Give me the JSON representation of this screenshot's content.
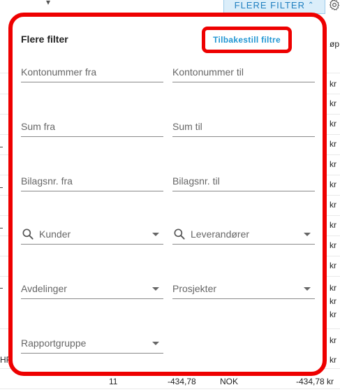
{
  "topbar": {
    "more_filters_label": "FLERE FILTER",
    "more_filters_chevron": "chevron-up-icon",
    "settings_icon": "gear-icon"
  },
  "background": {
    "column_header_fragment": "øp",
    "currency_cells": [
      "kr",
      "kr",
      "kr",
      "kr",
      "kr",
      "kr",
      "kr",
      "kr",
      "kr",
      "kr",
      "kr",
      "kr",
      "kr",
      "kr",
      "kr",
      "kr"
    ],
    "row_fragment": "HF",
    "bottom_row": {
      "count": "11",
      "amount": "-434,78",
      "currency": "NOK",
      "total": "-434,78 kr"
    }
  },
  "modal": {
    "title": "Flere filter",
    "reset_label": "Tilbakestill filtre",
    "fields": {
      "account_from": "Kontonummer fra",
      "account_to": "Kontonummer til",
      "sum_from": "Sum fra",
      "sum_to": "Sum til",
      "voucher_from": "Bilagsnr. fra",
      "voucher_to": "Bilagsnr. til",
      "customers": "Kunder",
      "suppliers": "Leverandører",
      "departments": "Avdelinger",
      "projects": "Prosjekter",
      "report_group": "Rapportgruppe"
    }
  },
  "colors": {
    "accent": "#2196d3",
    "highlight": "#ee0000",
    "button_bg": "#dbeefa"
  }
}
